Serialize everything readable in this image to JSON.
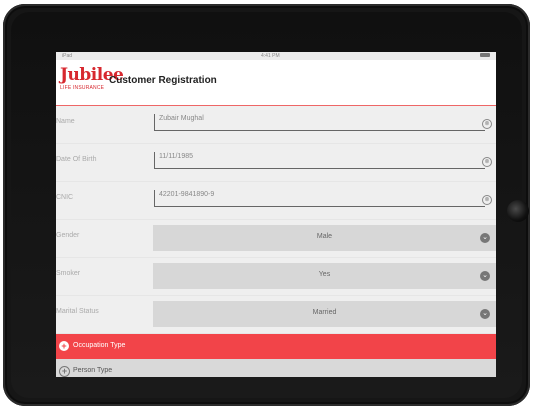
{
  "status_bar": {
    "carrier": "iPad",
    "time": "4:41 PM"
  },
  "header": {
    "logo_text": "Jubilee",
    "logo_sub": "LIFE INSURANCE",
    "title": "Customer Registration"
  },
  "form": {
    "name": {
      "label": "Name",
      "value": "Zubair Mughal"
    },
    "dob": {
      "label": "Date Of Birth",
      "value": "11/11/1985"
    },
    "cnic": {
      "label": "CNIC",
      "value": "42201-9841890-9"
    },
    "gender": {
      "label": "Gender",
      "value": "Male"
    },
    "smoker": {
      "label": "Smoker",
      "value": "Yes"
    },
    "marital": {
      "label": "Marital Status",
      "value": "Married"
    }
  },
  "sections": {
    "occupation": {
      "title": "Occupation Type"
    },
    "person": {
      "title": "Person Type"
    }
  },
  "icons": {
    "clear": "⊗",
    "chevron": "⌄",
    "plus": "+"
  },
  "colors": {
    "accent": "#f24449",
    "brand_red": "#d7282f"
  }
}
